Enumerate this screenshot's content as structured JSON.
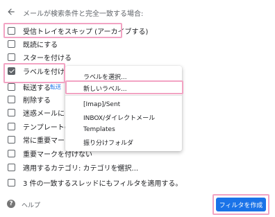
{
  "header": {
    "title": "メールが検索条件と完全一致する場合:"
  },
  "options": [
    {
      "label": "受信トレイをスキップ (アーカイブする)",
      "checked": false
    },
    {
      "label": "既読にする",
      "checked": false
    },
    {
      "label": "スターを付ける",
      "checked": false
    },
    {
      "label": "ラベルを付ける:",
      "checked": true
    },
    {
      "label": "転送する",
      "checked": false
    },
    {
      "label": "削除する",
      "checked": false
    },
    {
      "label": "迷惑メールにしな",
      "checked": false
    },
    {
      "label": "テンプレートの送",
      "checked": false
    },
    {
      "label": "常に重要マークを",
      "checked": false
    },
    {
      "label": "重要マークを付けない",
      "checked": false
    },
    {
      "label": "適用するカテゴリ: カテゴリを選択...",
      "checked": false
    },
    {
      "label": "3 件の一致するスレッドにもフィルタを適用する。",
      "checked": false
    }
  ],
  "forward_link": "転送",
  "label_menu": {
    "items": [
      "ラベルを選択...",
      "新しいラベル...",
      "[Imap]/Sent",
      "INBOX/ダイレクトメール",
      "Templates",
      "振り分けフォルダ"
    ]
  },
  "footer": {
    "help_label": "ヘルプ",
    "create_button": "フィルタを作成",
    "help_icon_glyph": "?"
  },
  "colors": {
    "accent": "#1a73e8",
    "highlight": "#f2a3c3"
  }
}
